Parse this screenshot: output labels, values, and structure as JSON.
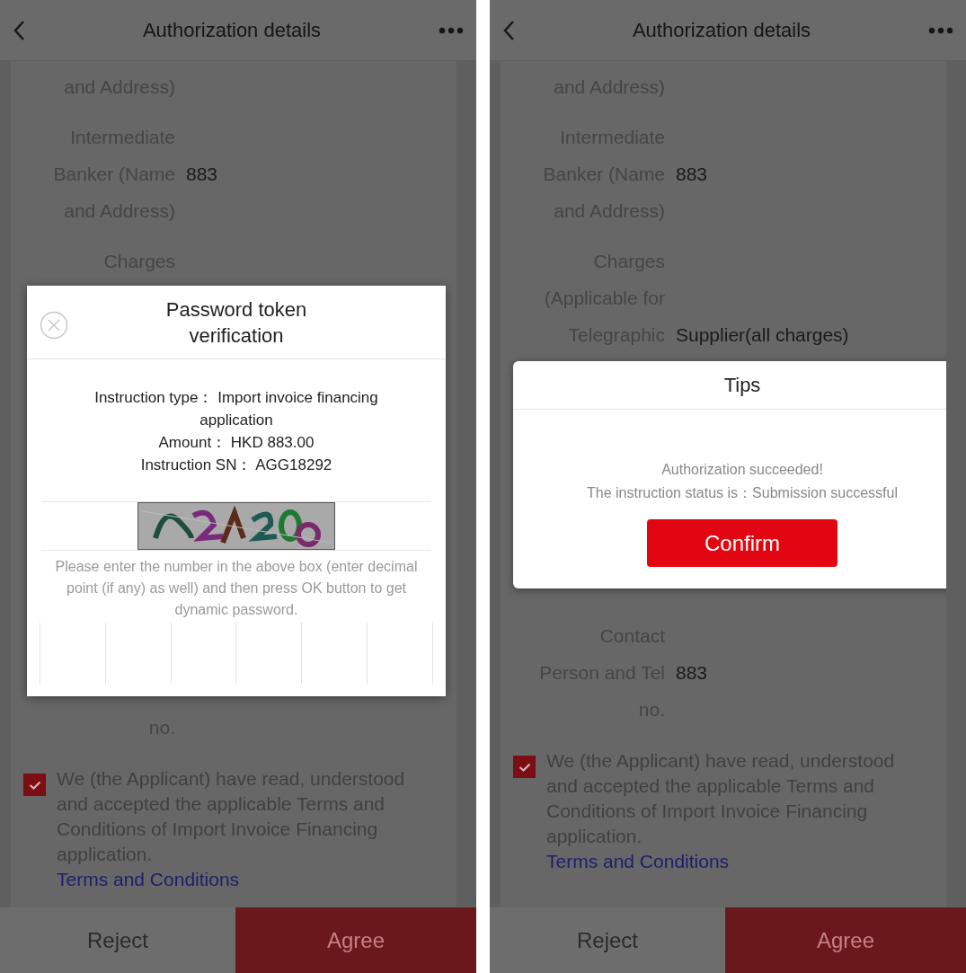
{
  "screens": [
    {
      "header": {
        "title": "Authorization details"
      },
      "rows_above": [
        {
          "lines": [
            {
              "label": "and Address)"
            }
          ]
        },
        {
          "lines": [
            {
              "label": "Intermediate"
            },
            {
              "label": "Banker (Name",
              "value": "883"
            },
            {
              "label": "and Address)"
            }
          ]
        },
        {
          "lines": [
            {
              "label": "Charges"
            }
          ]
        }
      ],
      "dialog": {
        "kind": "token",
        "title": "Password token verification",
        "details": [
          "Instruction type： Import invoice financing application",
          "Amount： HKD  883.00",
          "Instruction SN： AGG18292"
        ],
        "hint": "Please enter the number in the above box (enter decimal point (if any) as well) and then press OK button to get dynamic password."
      },
      "rows_below": [
        {
          "lines": [
            {
              "label": "no."
            }
          ]
        }
      ],
      "agreement": {
        "checked": true,
        "text": "We (the Applicant) have read, understood and accepted the applicable Terms and Conditions of Import Invoice Financing application.",
        "link": "Terms and Conditions"
      },
      "footer": [
        {
          "label": "Reject",
          "kind": "secondary"
        },
        {
          "label": "Agree",
          "kind": "primary"
        }
      ]
    },
    {
      "header": {
        "title": "Authorization details"
      },
      "rows_above": [
        {
          "lines": [
            {
              "label": "and Address)"
            }
          ]
        },
        {
          "lines": [
            {
              "label": "Intermediate"
            },
            {
              "label": "Banker (Name",
              "value": "883"
            },
            {
              "label": "and Address)"
            }
          ]
        },
        {
          "lines": [
            {
              "label": "Charges"
            },
            {
              "label": "(Applicable for"
            },
            {
              "label": "Telegraphic",
              "value": "Supplier(all charges)"
            }
          ]
        }
      ],
      "dialog": {
        "kind": "tips",
        "title": "Tips",
        "message_lines": [
          "Authorization succeeded!",
          "The instruction status is：Submission successful"
        ],
        "button": "Confirm"
      },
      "rows_below": [
        {
          "lines": [
            {
              "label": "Contact"
            },
            {
              "label": "Person and Tel",
              "value": "883"
            },
            {
              "label": "no."
            }
          ]
        }
      ],
      "agreement": {
        "checked": true,
        "text": "We (the Applicant) have read, understood and accepted the applicable Terms and Conditions of Import Invoice Financing application.",
        "link": "Terms and Conditions"
      },
      "footer": [
        {
          "label": "Reject",
          "kind": "secondary"
        },
        {
          "label": "Agree",
          "kind": "primary"
        }
      ]
    }
  ]
}
